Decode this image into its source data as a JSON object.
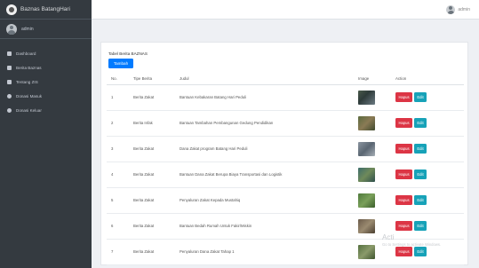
{
  "app": {
    "brand": "Baznas BatangHari"
  },
  "sidebar": {
    "user": "admin",
    "items": [
      {
        "label": "Dashboard"
      },
      {
        "label": "Berita Baznas"
      },
      {
        "label": "Tentang ZIS"
      },
      {
        "label": "Donasi Masuk"
      },
      {
        "label": "Donasi Keluar"
      }
    ]
  },
  "topbar": {
    "user": "admin"
  },
  "card": {
    "title": "Tabel Berita BAZNAS",
    "add_label": "Tambah"
  },
  "table": {
    "headers": {
      "no": "No.",
      "tipe": "Tipe Berita",
      "judul": "Judul",
      "image": "Image",
      "action": "Action"
    },
    "rows": [
      {
        "no": "1",
        "tipe": "Berita Zakat",
        "judul": "Bantuan Kebakaran Batang Hari Peduli",
        "hapus": "Hapus",
        "edit": "Edit"
      },
      {
        "no": "2",
        "tipe": "Berita Infak",
        "judul": "Bantuan Tambahan Pembangunan Gedung Pendidikan",
        "hapus": "Hapus",
        "edit": "Edit"
      },
      {
        "no": "3",
        "tipe": "Berita Zakat",
        "judul": "Dana Zakat program Batang Hari Peduli",
        "hapus": "Hapus",
        "edit": "Edit"
      },
      {
        "no": "4",
        "tipe": "Berita Zakat",
        "judul": "Bantuan Dana Zakat Berupa Biaya Transportasi dan Logistik",
        "hapus": "Hapus",
        "edit": "Edit"
      },
      {
        "no": "5",
        "tipe": "Berita Zakat",
        "judul": "Penyaluran Zakat Kepada Mustahiq",
        "hapus": "Hapus",
        "edit": "Edit"
      },
      {
        "no": "6",
        "tipe": "Berita Zakat",
        "judul": "Bantuan Bedah Rumah Untuk Fakir/Miskin",
        "hapus": "Hapus",
        "edit": "Edit"
      },
      {
        "no": "7",
        "tipe": "Berita Zakat",
        "judul": "Penyaluran Dana Zakat Tahap 1",
        "hapus": "Hapus",
        "edit": "Edit"
      }
    ]
  },
  "watermark": {
    "title": "Acti",
    "subtitle": "Go to Settings to activate Windows."
  }
}
